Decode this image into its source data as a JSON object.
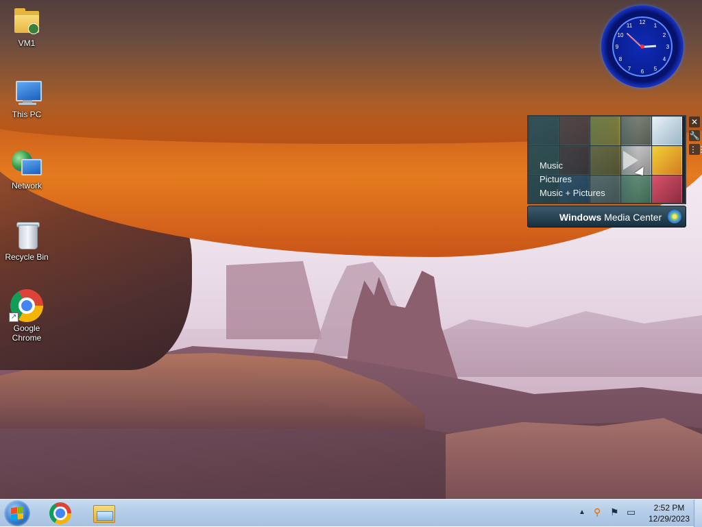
{
  "desktop_icons": [
    {
      "label": "VM1"
    },
    {
      "label": "This PC"
    },
    {
      "label": "Network"
    },
    {
      "label": "Recycle Bin"
    },
    {
      "label": "Google\nChrome"
    }
  ],
  "clock_gadget": {
    "numbers": [
      "12",
      "1",
      "2",
      "3",
      "4",
      "5",
      "6",
      "7",
      "8",
      "9",
      "10",
      "11"
    ],
    "time": "2:52"
  },
  "media_center": {
    "menu": [
      "Music",
      "Pictures",
      "Music + Pictures"
    ],
    "title_bold": "Windows",
    "title_rest": " Media Center"
  },
  "gadget_controls": {
    "close": "✕",
    "options": "🔧",
    "drag": "⋮⋮"
  },
  "taskbar": {
    "tray_icons": [
      "chevron-up-icon",
      "search-icon",
      "flag-icon",
      "network-icon"
    ],
    "time": "2:52 PM",
    "date": "12/29/2023"
  },
  "colors": {
    "taskbar": "#b5cde8",
    "clock_rim": "#5f8cff"
  }
}
